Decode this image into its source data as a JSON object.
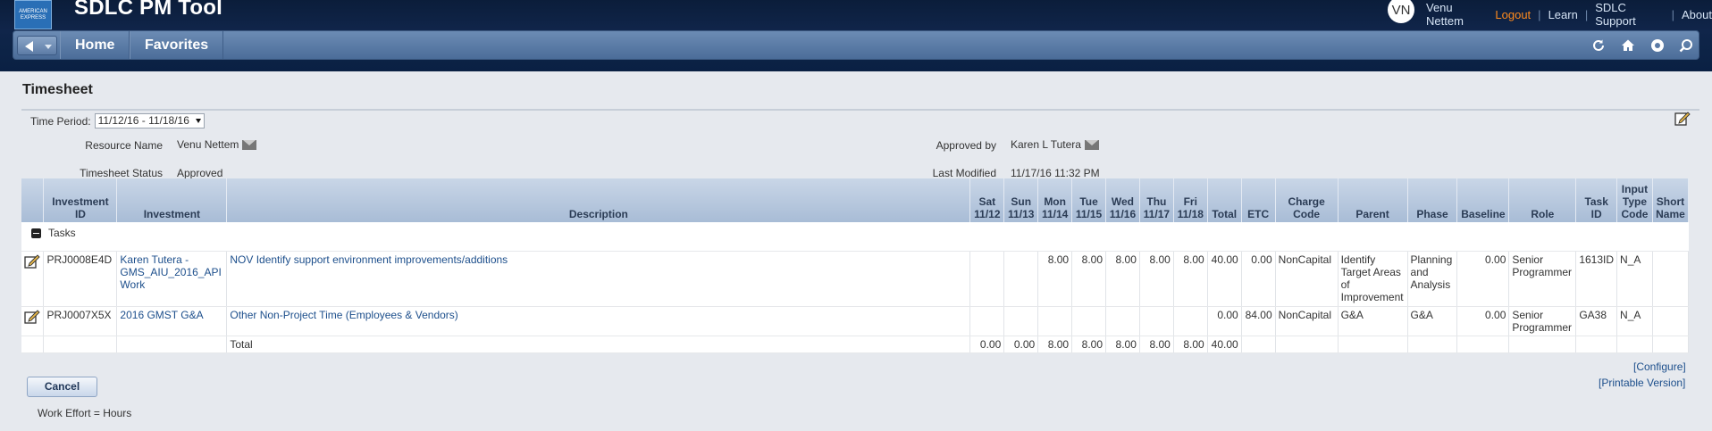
{
  "header": {
    "logo_text": "AMERICAN EXPRESS",
    "app_title": "SDLC PM Tool",
    "avatar_initials": "VN",
    "user_name": "Venu Nettem",
    "links": [
      "Logout",
      "Learn",
      "SDLC Support",
      "About"
    ]
  },
  "nav": {
    "tabs": [
      "Home",
      "Favorites"
    ],
    "icons": [
      "refresh-icon",
      "home-icon",
      "help-icon",
      "search-icon"
    ]
  },
  "page": {
    "title": "Timesheet",
    "time_period_label": "Time Period:",
    "time_period_value": "11/12/16 - 11/18/16"
  },
  "fields": {
    "resource_name_label": "Resource Name",
    "resource_name": "Venu Nettem",
    "timesheet_status_label": "Timesheet Status",
    "timesheet_status": "Approved",
    "approved_by_label": "Approved by",
    "approved_by": "Karen L Tutera",
    "last_modified_label": "Last Modified",
    "last_modified": "11/17/16 11:32 PM"
  },
  "table": {
    "headers": {
      "investment_id": "Investment ID",
      "investment": "Investment",
      "description": "Description",
      "sat": "Sat 11/12",
      "sun": "Sun 11/13",
      "mon": "Mon 11/14",
      "tue": "Tue 11/15",
      "wed": "Wed 11/16",
      "thu": "Thu 11/17",
      "fri": "Fri 11/18",
      "total": "Total",
      "etc": "ETC",
      "charge_code": "Charge Code",
      "parent": "Parent",
      "phase": "Phase",
      "baseline": "Baseline",
      "role": "Role",
      "task_id": "Task ID",
      "input_type_code": "Input Type Code",
      "short_name": "Short Name"
    },
    "group_label": "Tasks",
    "rows": [
      {
        "investment_id": "PRJ0008E4D",
        "investment": "Karen Tutera - GMS_AIU_2016_API Work",
        "description": "NOV Identify support environment improvements/additions",
        "sat": "",
        "sun": "",
        "mon": "8.00",
        "tue": "8.00",
        "wed": "8.00",
        "thu": "8.00",
        "fri": "8.00",
        "total": "40.00",
        "etc": "0.00",
        "charge_code": "NonCapital",
        "parent": "Identify Target Areas of Improvement",
        "phase": "Planning and Analysis",
        "baseline": "0.00",
        "role": "Senior Programmer",
        "task_id": "1613ID",
        "input_type_code": "N_A",
        "short_name": ""
      },
      {
        "investment_id": "PRJ0007X5X",
        "investment": "2016 GMST G&A",
        "description": "Other Non-Project Time (Employees & Vendors)",
        "sat": "",
        "sun": "",
        "mon": "",
        "tue": "",
        "wed": "",
        "thu": "",
        "fri": "",
        "total": "0.00",
        "etc": "84.00",
        "charge_code": "NonCapital",
        "parent": "G&A",
        "phase": "G&A",
        "baseline": "0.00",
        "role": "Senior Programmer",
        "task_id": "GA38",
        "input_type_code": "N_A",
        "short_name": ""
      }
    ],
    "totals": {
      "label": "Total",
      "sat": "0.00",
      "sun": "0.00",
      "mon": "8.00",
      "tue": "8.00",
      "wed": "8.00",
      "thu": "8.00",
      "fri": "8.00",
      "total": "40.00"
    }
  },
  "footer": {
    "configure": "[Configure]",
    "printable": "[Printable Version]",
    "cancel": "Cancel",
    "work_effort": "Work Effort = Hours"
  }
}
